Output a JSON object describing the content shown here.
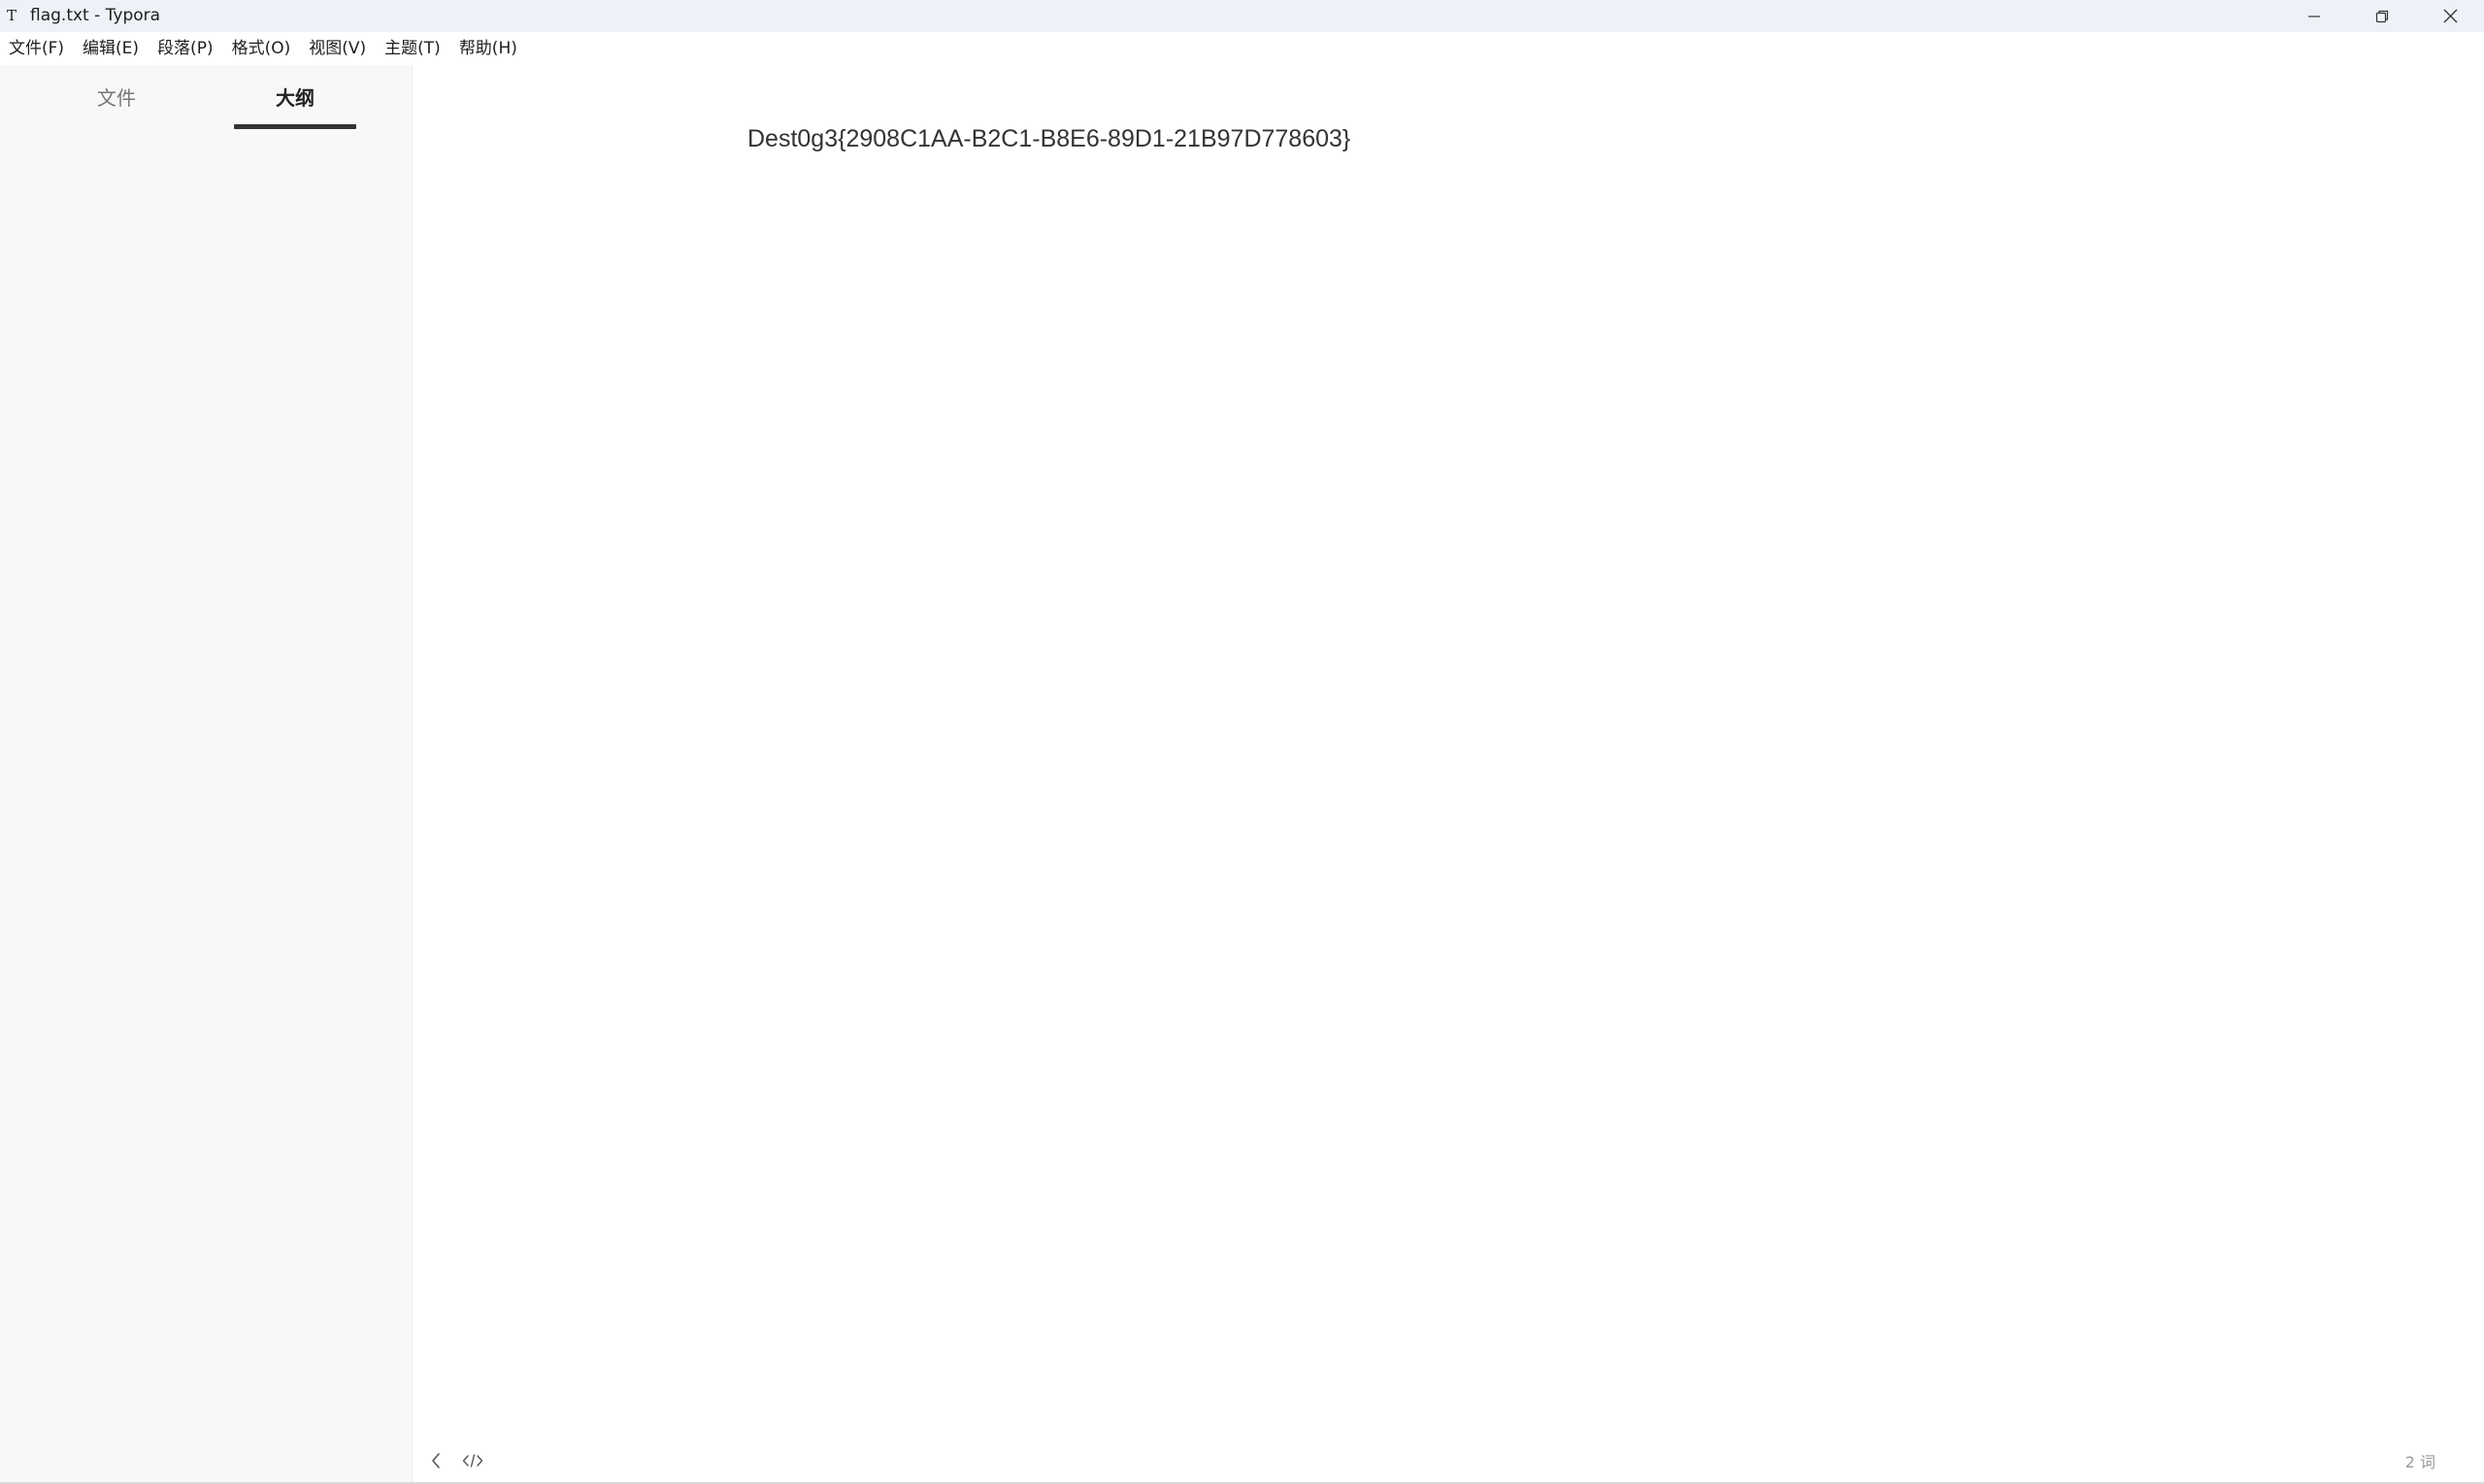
{
  "window": {
    "app_icon_glyph": "T",
    "title": "flag.txt - Typora",
    "controls": [
      "minimize-icon",
      "restore-icon",
      "close-icon"
    ]
  },
  "menubar": {
    "items": [
      {
        "label": "文件(F)"
      },
      {
        "label": "编辑(E)"
      },
      {
        "label": "段落(P)"
      },
      {
        "label": "格式(O)"
      },
      {
        "label": "视图(V)"
      },
      {
        "label": "主题(T)"
      },
      {
        "label": "帮助(H)"
      }
    ]
  },
  "sidebar": {
    "tabs": [
      {
        "label": "文件",
        "active": false
      },
      {
        "label": "大纲",
        "active": true
      }
    ]
  },
  "editor": {
    "content": "Dest0g3{2908C1AA-B2C1-B8E6-89D1-21B97D778603}"
  },
  "footer": {
    "icons": [
      "chevron-left-icon",
      "source-code-icon"
    ],
    "word_count": "2 词"
  },
  "colors": {
    "titlebar_bg": "#eef2f8",
    "sidebar_bg": "#f8f8f8",
    "active_tab_underline": "#333333",
    "text": "#333333"
  }
}
